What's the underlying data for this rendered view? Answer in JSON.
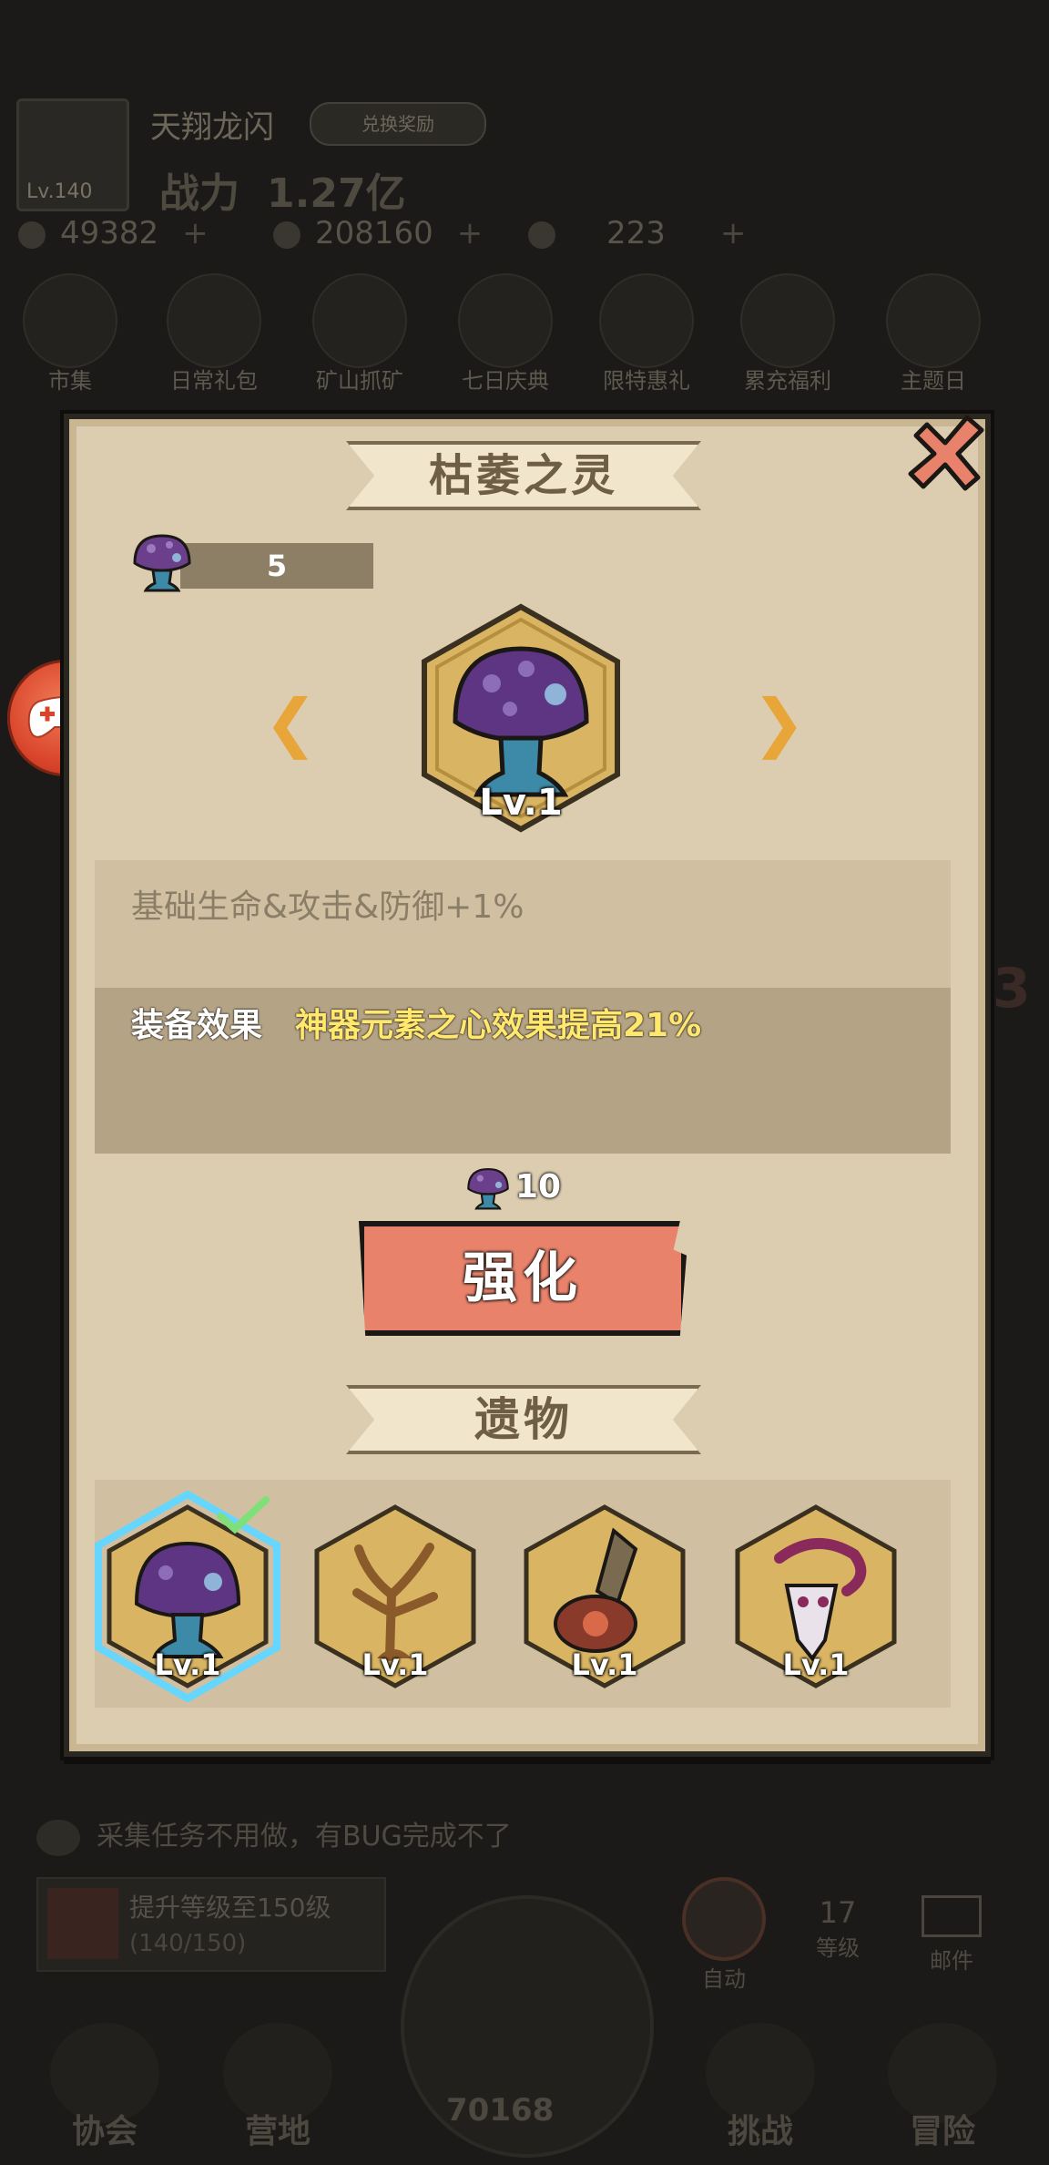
{
  "background": {
    "player": {
      "name": "天翔龙闪",
      "level": "Lv.140",
      "guild_badge": "兑换奖励"
    },
    "power": {
      "label": "战力",
      "value": "1.27亿"
    },
    "resources": [
      {
        "icon": "diamond-icon",
        "value": "49382"
      },
      {
        "icon": "coin-icon",
        "value": "208160"
      },
      {
        "icon": "star-icon",
        "value": "223"
      }
    ],
    "menu": [
      "市集",
      "日常礼包",
      "矿山抓矿",
      "七日庆典",
      "限特惠礼",
      "累充福利",
      "主题日"
    ],
    "chat": "采集任务不用做，有BUG完成不了",
    "quest": {
      "title": "提升等级至150级",
      "progress": "(140/150)"
    },
    "auto_label": "自动",
    "level": {
      "value": "17",
      "label": "等级"
    },
    "mail_label": "邮件",
    "nav": [
      "协会",
      "营地",
      "挑战",
      "冒险"
    ],
    "center_value": "70168"
  },
  "modal": {
    "title": "枯萎之灵",
    "owned_count": "5",
    "current_item": {
      "name": "purple-mushroom",
      "level": "Lv.1"
    },
    "base_effect": "基础生命&攻击&防御+1%",
    "equip_effect_label": "装备效果",
    "equip_effect_value": "神器元素之心效果提高21%",
    "cost": "10",
    "upgrade_label": "强化",
    "section_title": "遗物",
    "relics": [
      {
        "name": "purple-mushroom",
        "level": "Lv.1",
        "selected": true
      },
      {
        "name": "withered-tree",
        "level": "Lv.1",
        "selected": false
      },
      {
        "name": "ancient-seal",
        "level": "Lv.1",
        "selected": false
      },
      {
        "name": "serpent-mask",
        "level": "Lv.1",
        "selected": false
      }
    ]
  },
  "colors": {
    "panel": "#dccdb0",
    "upgrade_button": "#e8826a",
    "highlight_text": "#ffe86b",
    "arrow": "#e8a63a",
    "selection_glow": "#66d6ff"
  }
}
